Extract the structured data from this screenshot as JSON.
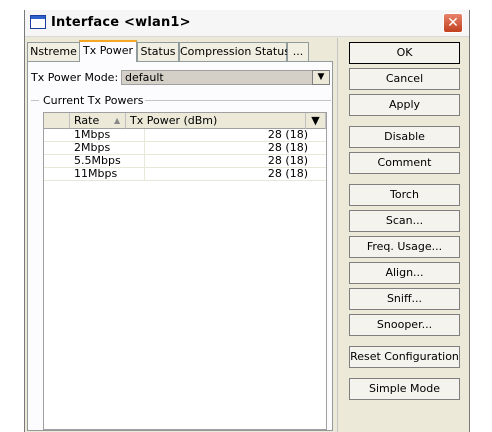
{
  "window": {
    "title": "Interface <wlan1>"
  },
  "tabs": [
    "Nstreme",
    "Tx Power",
    "Status",
    "Compression Status",
    "..."
  ],
  "form": {
    "tx_power_mode_label": "Tx Power Mode:",
    "tx_power_mode_value": "default"
  },
  "group": {
    "label": "Current Tx Powers"
  },
  "table": {
    "columns": [
      "Rate",
      "Tx Power (dBm)"
    ],
    "rows": [
      {
        "rate": "1Mbps",
        "power": "28 (18)"
      },
      {
        "rate": "2Mbps",
        "power": "28 (18)"
      },
      {
        "rate": "5.5Mbps",
        "power": "28 (18)"
      },
      {
        "rate": "11Mbps",
        "power": "28 (18)"
      }
    ]
  },
  "buttons": {
    "ok": "OK",
    "cancel": "Cancel",
    "apply": "Apply",
    "disable": "Disable",
    "comment": "Comment",
    "torch": "Torch",
    "scan": "Scan...",
    "freq_usage": "Freq. Usage...",
    "align": "Align...",
    "sniff": "Sniff...",
    "snooper": "Snooper...",
    "reset_configuration": "Reset Configuration",
    "simple_mode": "Simple Mode"
  }
}
